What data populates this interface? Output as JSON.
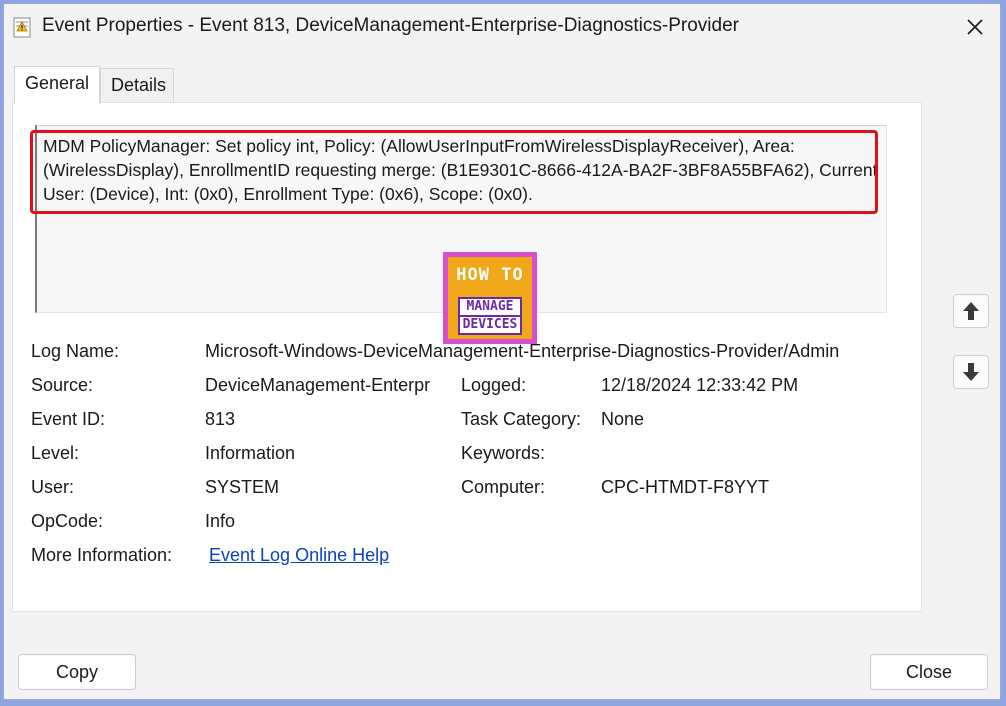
{
  "window": {
    "title": "Event Properties - Event 813, DeviceManagement-Enterprise-Diagnostics-Provider"
  },
  "tabs": [
    {
      "label": "General",
      "active": true
    },
    {
      "label": "Details",
      "active": false
    }
  ],
  "description": "MDM PolicyManager: Set policy int, Policy: (AllowUserInputFromWirelessDisplayReceiver), Area: (WirelessDisplay), EnrollmentID requesting merge: (B1E9301C-8666-412A-BA2F-3BF8A55BFA62), Current User: (Device), Int: (0x0), Enrollment Type: (0x6), Scope: (0x0).",
  "logo": {
    "line1": "HOW TO",
    "line2": "MANAGE",
    "line3": "DEVICES"
  },
  "fields": {
    "log_name_label": "Log Name:",
    "log_name_value": "Microsoft-Windows-DeviceManagement-Enterprise-Diagnostics-Provider/Admin",
    "source_label": "Source:",
    "source_value": "DeviceManagement-Enterpr",
    "logged_label": "Logged:",
    "logged_value": "12/18/2024 12:33:42 PM",
    "event_id_label": "Event ID:",
    "event_id_value": "813",
    "task_category_label": "Task Category:",
    "task_category_value": "None",
    "level_label": "Level:",
    "level_value": "Information",
    "keywords_label": "Keywords:",
    "keywords_value": "",
    "user_label": "User:",
    "user_value": "SYSTEM",
    "computer_label": "Computer:",
    "computer_value": "CPC-HTMDT-F8YYT",
    "opcode_label": "OpCode:",
    "opcode_value": "Info",
    "more_info_label": "More Information:",
    "more_info_link": "Event Log Online Help"
  },
  "buttons": {
    "copy": "Copy",
    "close": "Close"
  },
  "colors": {
    "highlight": "#e0111c",
    "link": "#0b3fc7",
    "frame": "#8ea6df"
  }
}
